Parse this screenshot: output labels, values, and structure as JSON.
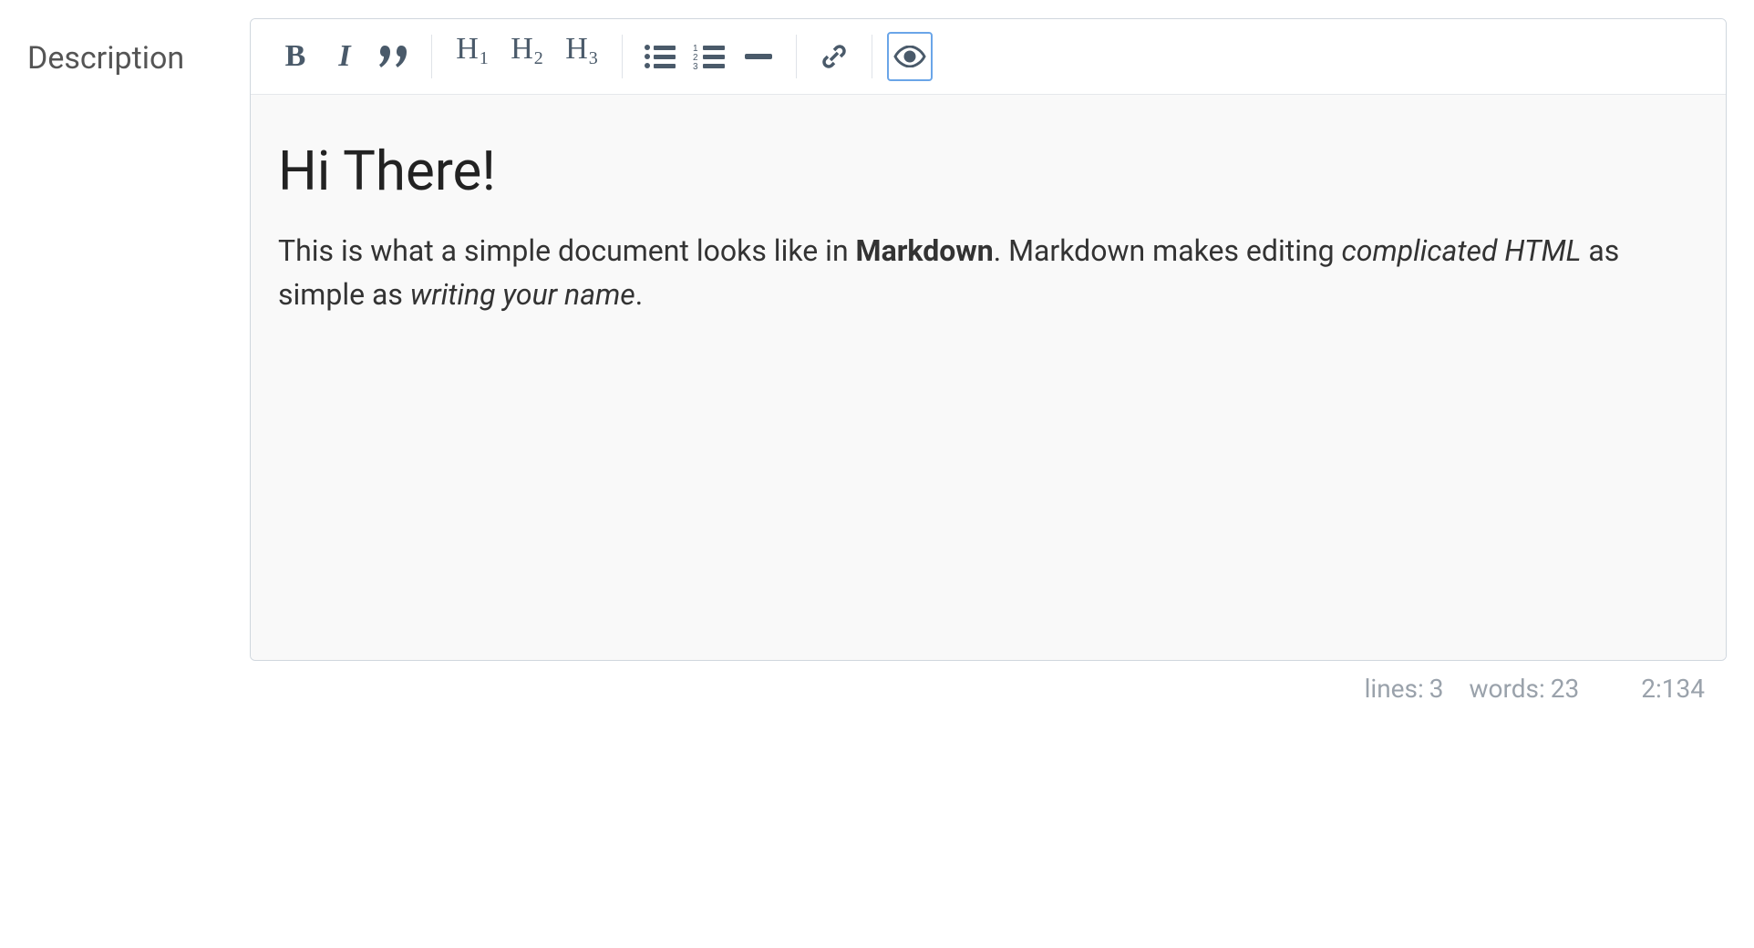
{
  "label": "Description",
  "toolbar": {
    "bold": "B",
    "italic": "I",
    "quote": "quote-icon",
    "h1": {
      "letter": "H",
      "sub": "1"
    },
    "h2": {
      "letter": "H",
      "sub": "2"
    },
    "h3": {
      "letter": "H",
      "sub": "3"
    },
    "ul": "unordered-list-icon",
    "ol": "ordered-list-icon",
    "hr": "horizontal-rule-icon",
    "link": "link-icon",
    "preview": "eye-icon"
  },
  "content": {
    "heading": "Hi There!",
    "p1": "This is what a simple document looks like in ",
    "bold1": "Markdown",
    "p2": ". Markdown makes editing ",
    "italic1": "complicated HTML",
    "p3": " as simple as ",
    "italic2": "writing your name",
    "p4": "."
  },
  "status": {
    "lines_label": "lines:",
    "lines_value": "3",
    "words_label": "words:",
    "words_value": "23",
    "cursor": "2:134"
  }
}
